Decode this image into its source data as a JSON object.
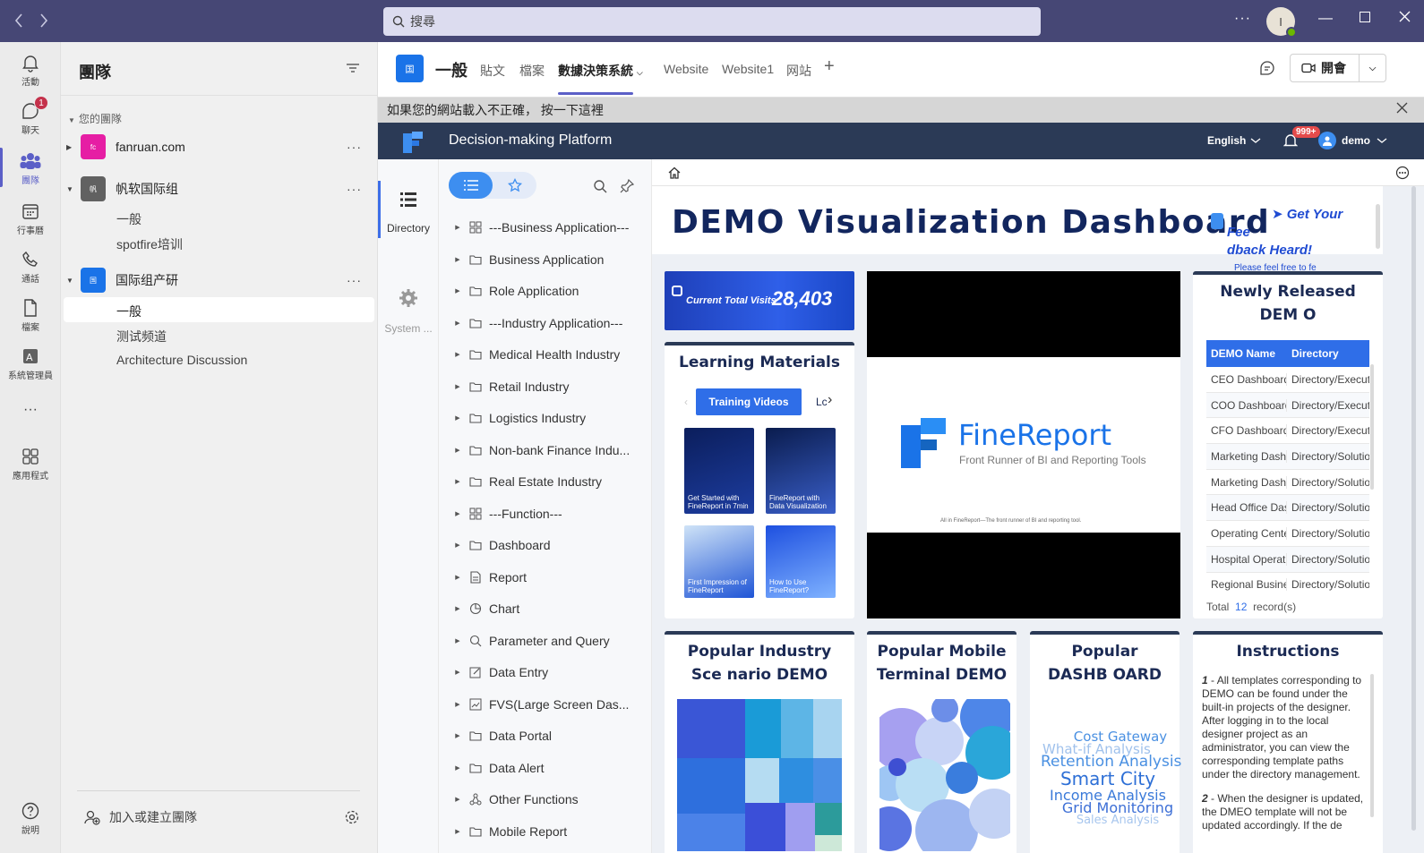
{
  "titlebar": {
    "search_placeholder": "搜尋",
    "avatar_initial": "I"
  },
  "rail": {
    "items": [
      {
        "label": "活動"
      },
      {
        "label": "聊天",
        "badge": "1"
      },
      {
        "label": "團隊"
      },
      {
        "label": "行事曆"
      },
      {
        "label": "通話"
      },
      {
        "label": "檔案"
      },
      {
        "label": "系統管理員"
      },
      {
        "label": "應用程式"
      },
      {
        "label": "說明"
      }
    ]
  },
  "teams_panel": {
    "title": "團隊",
    "section_label": "您的團隊",
    "teams": [
      {
        "name": "fanruan.com",
        "icon_text": "fc",
        "color": "#e61ea4"
      },
      {
        "name": "帆软国际组",
        "icon_text": "帆",
        "color": "#616161"
      },
      {
        "name": "国际组产研",
        "icon_text": "国",
        "color": "#1a73e8"
      }
    ],
    "channels": [
      "一般",
      "spotfire培训",
      "一般",
      "测试频道",
      "Architecture Discussion"
    ],
    "join_label": "加入或建立團隊"
  },
  "channel_header": {
    "logo_text": "国",
    "name": "一般",
    "tabs": [
      "貼文",
      "檔案",
      "數據決策系統",
      "Website",
      "Website1",
      "网站"
    ],
    "meet_label": "開會"
  },
  "notification": {
    "text": "如果您的網站載入不正確， 按一下這裡"
  },
  "platform": {
    "title": "Decision-making Platform",
    "language": "English",
    "notif_badge": "999+",
    "user": "demo",
    "nav": [
      {
        "label": "Directory"
      },
      {
        "label": "System ..."
      }
    ],
    "directory": [
      {
        "label": "---Business Application---",
        "icon": "grid-icon"
      },
      {
        "label": "Business Application",
        "icon": "folder-icon"
      },
      {
        "label": "Role Application",
        "icon": "folder-icon"
      },
      {
        "label": "---Industry Application---",
        "icon": "folder-icon"
      },
      {
        "label": "Medical Health Industry",
        "icon": "folder-icon"
      },
      {
        "label": "Retail Industry",
        "icon": "folder-icon"
      },
      {
        "label": "Logistics Industry",
        "icon": "folder-icon"
      },
      {
        "label": "Non-bank Finance Indu...",
        "icon": "folder-icon"
      },
      {
        "label": "Real Estate Industry",
        "icon": "folder-icon"
      },
      {
        "label": "---Function---",
        "icon": "grid-icon"
      },
      {
        "label": "Dashboard",
        "icon": "folder-icon"
      },
      {
        "label": "Report",
        "icon": "doc-icon"
      },
      {
        "label": "Chart",
        "icon": "pie-icon"
      },
      {
        "label": "Parameter and Query",
        "icon": "query-icon"
      },
      {
        "label": "Data Entry",
        "icon": "edit-icon"
      },
      {
        "label": "FVS(Large Screen Das...",
        "icon": "screen-icon"
      },
      {
        "label": "Data Portal",
        "icon": "folder-icon"
      },
      {
        "label": "Data Alert",
        "icon": "folder-icon"
      },
      {
        "label": "Other Functions",
        "icon": "share-icon"
      },
      {
        "label": "Mobile Report",
        "icon": "folder-icon"
      }
    ]
  },
  "dashboard": {
    "banner_title": "DEMO Visualization Dashboard",
    "feedback_line1": "➤ Get Your Fee",
    "feedback_line2": "dback Heard!",
    "feedback_sub": "Please feel free to fe",
    "visits_label": "Current Total Visits",
    "visits_value": "28,403",
    "learning_title": "Learning Materials",
    "learning_tab_active": "Training Videos",
    "learning_tab_next": "Lc",
    "thumbs": [
      {
        "caption": "Get Started with FineReport in 7min"
      },
      {
        "caption": "FineReport with Data Visualization"
      },
      {
        "caption": "First Impression of FineReport"
      },
      {
        "caption": "How to Use FineReport?"
      }
    ],
    "video_brand": "FineReport",
    "video_sub": "Front Runner of BI and Reporting Tools",
    "video_tiny": "All in FineReport—The front runner of BI and reporting tool.",
    "newly_title": "Newly Released DEM O",
    "table_headers": [
      "DEMO Name",
      "Directory"
    ],
    "table_rows": [
      [
        "CEO Dashboard",
        "Directory/Executi"
      ],
      [
        "COO Dashboard",
        "Directory/Executi"
      ],
      [
        "CFO Dashboard",
        "Directory/Executi"
      ],
      [
        "Marketing Dashb",
        "Directory/Solutio"
      ],
      [
        "Marketing Dashb",
        "Directory/Solutio"
      ],
      [
        "Head Office Das",
        "Directory/Solutio"
      ],
      [
        "Operating Cente",
        "Directory/Solutio"
      ],
      [
        "Hospital Operati",
        "Directory/Solutio"
      ],
      [
        "Regional Busine",
        "Directory/Solutio"
      ]
    ],
    "total_prefix": "Total",
    "total_count": "12",
    "total_suffix": "record(s)",
    "industry_title": "Popular Industry Sce nario DEMO",
    "mobile_title": "Popular Mobile Terminal DEMO",
    "dashb_title": "Popular DASHB OARD",
    "instructions_title": "Instructions",
    "wordcloud": [
      "Cost Gateway",
      "What-if Analysis",
      "Retention Analysis",
      "Smart City",
      "Income Analysis",
      "Grid Monitoring",
      "Sales Analysis"
    ],
    "instructions": [
      {
        "num": "1",
        "text": " - All templates corresponding to DEMO can be found under the built-in projects of the designer. After logging in to the local designer project as an administrator, you can view the corresponding template paths under the directory management."
      },
      {
        "num": "2",
        "text": " - When the designer is updated, the DMEO template will not be updated accordingly. If the de"
      }
    ]
  }
}
